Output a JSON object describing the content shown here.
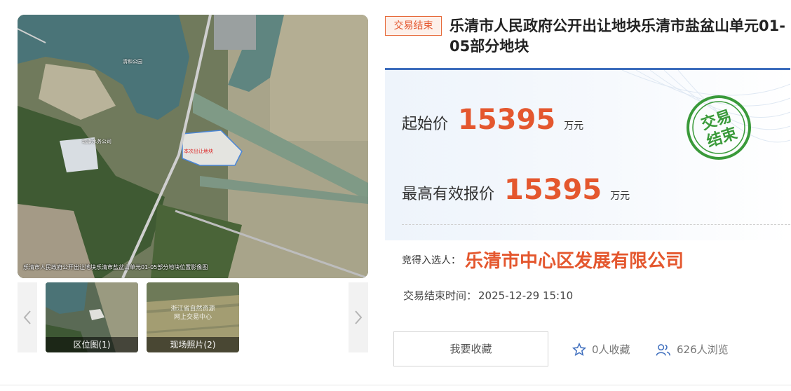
{
  "map": {
    "caption": "乐清市人民政府公开出让地块乐清市盐盆山单元01-05部分地块位置影像图",
    "park_label": "清和公园",
    "site_label": "本次出让地块",
    "left_label": "瑞康水务公司"
  },
  "thumbs": [
    {
      "label": "区位图(1)"
    },
    {
      "label": "现场照片(2)",
      "watermark_line1": "浙江省自然资源",
      "watermark_line2": "网上交易中心"
    }
  ],
  "status_tag": "交易结束",
  "title": "乐清市人民政府公开出让地块乐清市盐盆山单元01-05部分地块",
  "stamp": {
    "line1": "交易",
    "line2": "结束",
    "color": "#3a9a3a"
  },
  "starting_price": {
    "label": "起始价",
    "value": "15395",
    "unit": "万元"
  },
  "highest_bid": {
    "label": "最高有效报价",
    "value": "15395",
    "unit": "万元"
  },
  "winner": {
    "label": "竞得入选人：",
    "name": "乐清市中心区发展有限公司"
  },
  "end_time": {
    "label": "交易结束时间：",
    "value": "2025-12-29 15:10"
  },
  "actions": {
    "favorite_label": "我要收藏"
  },
  "stats": {
    "favorites": "0人收藏",
    "views": "626人浏览"
  },
  "colors": {
    "accent": "#e4572e",
    "blue": "#3d6dbd"
  }
}
